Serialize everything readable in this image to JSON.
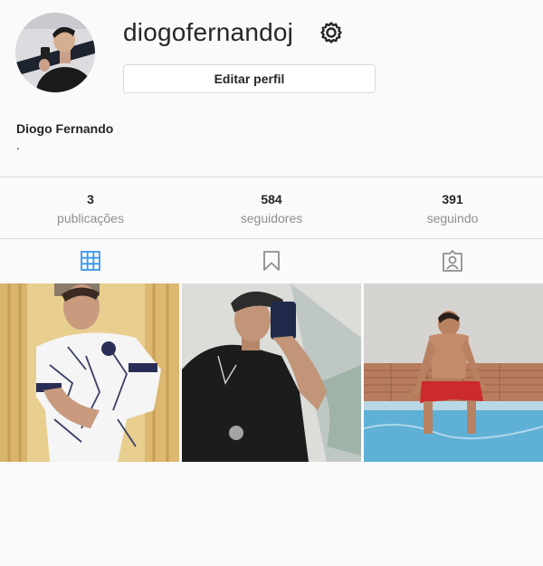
{
  "profile": {
    "username": "diogofernandoj",
    "edit_label": "Editar perfil",
    "full_name": "Diogo Fernando",
    "bio": "."
  },
  "stats": [
    {
      "value": "3",
      "label": "publicações"
    },
    {
      "value": "584",
      "label": "seguidores"
    },
    {
      "value": "391",
      "label": "seguindo"
    }
  ],
  "tabs": [
    {
      "icon": "grid-icon",
      "active": true
    },
    {
      "icon": "bookmark-icon",
      "active": false
    },
    {
      "icon": "tagged-icon",
      "active": false
    }
  ],
  "posts": [
    {
      "description": "man in white patterned football shirt by yellow curtain"
    },
    {
      "description": "man in black t-shirt and cap taking mirror selfie"
    },
    {
      "description": "man in red shorts sitting at edge of blue pool"
    }
  ],
  "colors": {
    "accent": "#3897f0",
    "text": "#262626",
    "muted": "#8e8e8e",
    "border": "#dbdbdb",
    "background": "#fafafa"
  }
}
